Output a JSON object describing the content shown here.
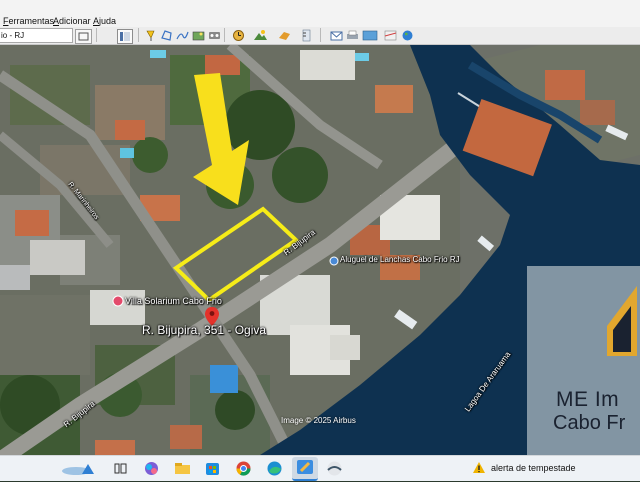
{
  "menu": {
    "items": [
      {
        "label": "Ferramentas",
        "hotkey": "F",
        "rest": "erramentas"
      },
      {
        "label": "Adicionar",
        "hotkey": "A",
        "rest": "dicionar"
      },
      {
        "label": "Ajuda",
        "hotkey": "A",
        "rest": "juda"
      }
    ]
  },
  "toolbar": {
    "search_value": "io - RJ",
    "icons": [
      "sidebar-toggle-icon",
      "placemark-icon",
      "polygon-icon",
      "path-icon",
      "image-overlay-icon",
      "tour-icon",
      "historical-imagery-icon",
      "sunlight-icon",
      "planets-icon",
      "ruler-icon",
      "email-icon",
      "print-icon",
      "save-image-icon",
      "maps-icon",
      "earth-icon"
    ]
  },
  "map": {
    "labels": {
      "street_main": "R. Bijupira, 351 - Ogiva",
      "villa": "Villa Solarium Cabo Frio",
      "street_top": "R. Bijupira",
      "street_left_upper": "R. Marinheiros",
      "street_left_lower": "R. Bijupira",
      "aluguel": "Aluguel de Lanchas Cabo Frio RJ",
      "lagoa": "Lagoa De Araruama",
      "attribution": "Image © 2025 Airbus"
    },
    "watermark": {
      "line1": "ME Im",
      "line2": "Cabo Fr"
    }
  },
  "taskbar": {
    "alert_text": "alerta de tempestade",
    "apps": [
      "weather-icon",
      "task-view-icon",
      "copilot-icon",
      "file-explorer-icon",
      "store-icon",
      "chrome-icon",
      "edge-icon",
      "paint-icon",
      "google-earth-icon"
    ]
  },
  "colors": {
    "water": "#0d3050",
    "highlight": "#f6ec18",
    "arrow": "#f8df1c",
    "pin": "#e4322b"
  }
}
